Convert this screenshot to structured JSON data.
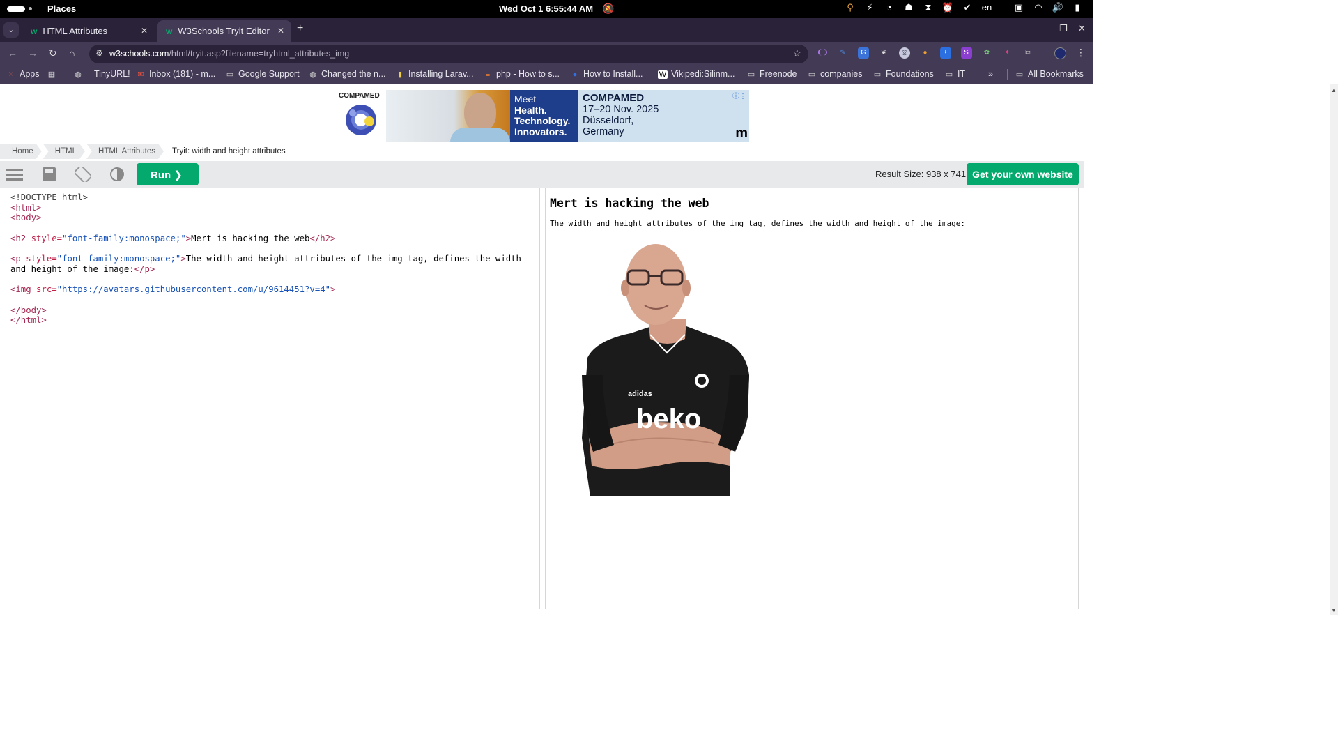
{
  "system": {
    "places": "Places",
    "datetime": "Wed Oct 1 6:55:44 AM",
    "date": "Wed Oct 1",
    "time": "6:55:44 AM",
    "language": "en",
    "tray_icons": [
      "search-icon",
      "bolt-icon",
      "timer-icon",
      "ghost-icon",
      "hourglass-icon",
      "alarm-icon",
      "check-icon",
      "language-indicator",
      "screen-icon",
      "wifi-icon",
      "volume-icon",
      "battery-icon"
    ]
  },
  "tabs": [
    {
      "title": "HTML Attributes",
      "active": false
    },
    {
      "title": "W3Schools Tryit Editor",
      "active": true
    }
  ],
  "address": {
    "domain": "w3schools.com",
    "path": "/html/tryit.asp?filename=tryhtml_attributes_img"
  },
  "bookmarks": [
    {
      "label": "Apps",
      "icon": "apps-grid-icon"
    },
    {
      "label": "",
      "icon": "grid-icon"
    },
    {
      "label": "",
      "icon": "globe-icon"
    },
    {
      "label": "TinyURL!",
      "icon": ""
    },
    {
      "label": "Inbox (181) - m...",
      "icon": "mail-icon"
    },
    {
      "label": "Google Support",
      "icon": "folder-icon"
    },
    {
      "label": "Changed the n...",
      "icon": "globe-icon"
    },
    {
      "label": "Installing Larav...",
      "icon": "bookmark-icon"
    },
    {
      "label": "php - How to s...",
      "icon": "stack-icon"
    },
    {
      "label": "How to Install...",
      "icon": "site-icon"
    },
    {
      "label": "Vikipedi:Silinm...",
      "icon": "wikipedia-icon"
    },
    {
      "label": "Freenode",
      "icon": "folder-icon"
    },
    {
      "label": "companies",
      "icon": "folder-icon"
    },
    {
      "label": "Foundations",
      "icon": "folder-icon"
    },
    {
      "label": "IT",
      "icon": "folder-icon"
    },
    {
      "label": "All Bookmarks",
      "icon": "folder-icon"
    }
  ],
  "ad": {
    "brand": "COMPAMED",
    "meet_line1": "Meet",
    "meet_line2": "Health.",
    "meet_line3": "Technology.",
    "meet_line4": "Innovators.",
    "title": "COMPAMED",
    "dates": "17–20 Nov. 2025",
    "city": "Düsseldorf,",
    "country": "Germany",
    "mark": "m"
  },
  "breadcrumb": [
    "Home",
    "HTML",
    "HTML Attributes",
    "Tryit: width and height attributes"
  ],
  "toolbar": {
    "run_label": "Run ❯",
    "result_size": "Result Size: 938 x 741",
    "get_website": "Get your own website"
  },
  "editor": {
    "l1": "<!DOCTYPE html>",
    "l2": "<html>",
    "l3": "<body>",
    "h2_open_tag": "<h2",
    "h2_attr": " style=",
    "h2_val": "\"font-family:monospace;\"",
    "h2_close_bracket": ">",
    "h2_text": "Mert is hacking the web",
    "h2_close": "</h2>",
    "p_open_tag": "<p",
    "p_attr": " style=",
    "p_val": "\"font-family:monospace;\"",
    "p_close_bracket": ">",
    "p_text1": "The width and height attributes of the img tag, defines the width",
    "p_text2": "and height of the image:",
    "p_close": "</p>",
    "img_tag": "<img",
    "img_attr": " src=",
    "img_val": "\"https://avatars.githubusercontent.com/u/9614451?v=4\"",
    "img_close": ">",
    "l_body_close": "</body>",
    "l_html_close": "</html>"
  },
  "result": {
    "heading": "Mert is hacking the web",
    "paragraph": "The width and height attributes of the img tag, defines the width and height of the image:",
    "shirt_text": "beko",
    "colors": {
      "shirt": "#1b1b1b",
      "skin": "#d9a690"
    }
  },
  "colors": {
    "accent": "#04aa6d",
    "tab_bg": "#2a2238",
    "toolbar_bg": "#433a55"
  }
}
